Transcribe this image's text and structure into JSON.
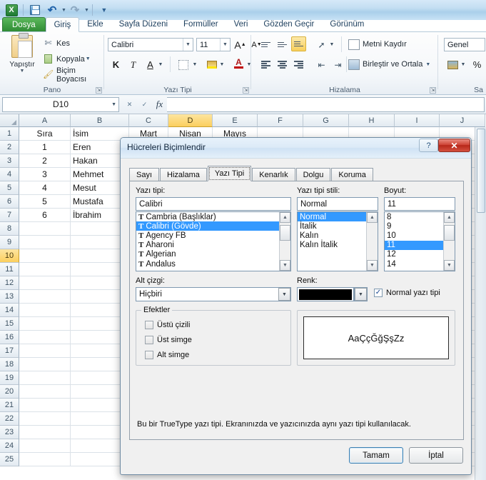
{
  "quick_access": {
    "app_icon": "excel-logo-icon",
    "items": [
      {
        "name": "save-icon",
        "label": ""
      },
      {
        "name": "undo-icon",
        "label": "↶"
      },
      {
        "name": "redo-icon",
        "label": "↷"
      },
      {
        "name": "customize-qat-icon",
        "label": "▾"
      }
    ]
  },
  "ribbon": {
    "tabs": [
      {
        "label": "Dosya",
        "state": "file"
      },
      {
        "label": "Giriş",
        "state": "active"
      },
      {
        "label": "Ekle",
        "state": "normal"
      },
      {
        "label": "Sayfa Düzeni",
        "state": "normal"
      },
      {
        "label": "Formüller",
        "state": "normal"
      },
      {
        "label": "Veri",
        "state": "normal"
      },
      {
        "label": "Gözden Geçir",
        "state": "normal"
      },
      {
        "label": "Görünüm",
        "state": "normal"
      }
    ],
    "groups": {
      "clipboard": {
        "label": "Pano",
        "paste": "Yapıştır",
        "cut": "Kes",
        "copy": "Kopyala",
        "format_painter": "Biçim Boyacısı"
      },
      "font": {
        "label": "Yazı Tipi",
        "font_name": "Calibri",
        "font_size": "11",
        "grow": "A",
        "shrink": "A",
        "bold": "K",
        "italic": "T",
        "underline": "A",
        "borders": "borders-icon",
        "fill": "fill-color-icon",
        "fontcolor": "A"
      },
      "alignment": {
        "label": "Hizalama",
        "wrap_text": "Metni Kaydır",
        "merge_center": "Birleştir ve Ortala"
      },
      "number": {
        "label": "Sa",
        "format": "Genel",
        "percent": "%"
      }
    }
  },
  "formula_bar": {
    "name_box": "D10",
    "formula": "",
    "fx_label": "fx",
    "cancel_icon": "cancel-icon",
    "accept_icon": "accept-icon"
  },
  "sheet": {
    "columns": [
      "A",
      "B",
      "C",
      "D",
      "E",
      "F",
      "G",
      "H",
      "I",
      "J"
    ],
    "selected_column": "D",
    "rows": [
      "1",
      "2",
      "3",
      "4",
      "5",
      "6",
      "7",
      "8",
      "9",
      "10",
      "11",
      "12",
      "13",
      "14",
      "15",
      "16",
      "17",
      "18",
      "19",
      "20",
      "21",
      "22",
      "23",
      "24",
      "25"
    ],
    "selected_row": "10",
    "active_cell": "D10",
    "data": [
      [
        "Sıra",
        "İsim",
        "Mart",
        "Nisan",
        "Mayıs",
        "",
        "",
        "",
        "",
        ""
      ],
      [
        "1",
        "Eren",
        "",
        "",
        "",
        "",
        "",
        "",
        "",
        ""
      ],
      [
        "2",
        "Hakan",
        "",
        "",
        "",
        "",
        "",
        "",
        "",
        ""
      ],
      [
        "3",
        "Mehmet",
        "",
        "",
        "",
        "",
        "",
        "",
        "",
        ""
      ],
      [
        "4",
        "Mesut",
        "",
        "",
        "",
        "",
        "",
        "",
        "",
        ""
      ],
      [
        "5",
        "Mustafa",
        "",
        "",
        "",
        "",
        "",
        "",
        "",
        ""
      ],
      [
        "6",
        "İbrahim",
        "",
        "",
        "",
        "",
        "",
        "",
        "",
        ""
      ]
    ]
  },
  "dialog": {
    "title": "Hücreleri Biçimlendir",
    "help_btn": "?",
    "close_btn": "✕",
    "tabs": [
      {
        "label": "Sayı",
        "active": false
      },
      {
        "label": "Hizalama",
        "active": false
      },
      {
        "label": "Yazı Tipi",
        "active": true
      },
      {
        "label": "Kenarlık",
        "active": false
      },
      {
        "label": "Dolgu",
        "active": false
      },
      {
        "label": "Koruma",
        "active": false
      }
    ],
    "font": {
      "label": "Yazı tipi:",
      "value": "Calibri",
      "options": [
        "Cambria (Başlıklar)",
        "Calibri (Gövde)",
        "Agency FB",
        "Aharoni",
        "Algerian",
        "Andalus"
      ],
      "selected_index": 1
    },
    "style": {
      "label": "Yazı tipi stili:",
      "value": "Normal",
      "options": [
        "Normal",
        "İtalik",
        "Kalın",
        "Kalın İtalik"
      ],
      "selected_index": 0
    },
    "size": {
      "label": "Boyut:",
      "value": "11",
      "options": [
        "8",
        "9",
        "10",
        "11",
        "12",
        "14"
      ],
      "selected_index": 3
    },
    "underline": {
      "label": "Alt çizgi:",
      "value": "Hiçbiri"
    },
    "color": {
      "label": "Renk:",
      "value": "#000000"
    },
    "normal_font": {
      "label": "Normal yazı tipi",
      "checked": true
    },
    "effects": {
      "legend": "Efektler",
      "items": [
        {
          "label": "Üstü çizili",
          "checked": false
        },
        {
          "label": "Üst simge",
          "checked": false
        },
        {
          "label": "Alt simge",
          "checked": false
        }
      ]
    },
    "preview": {
      "text": "AaÇçĞğŞşZz"
    },
    "note": "Bu bir TrueType yazı tipi. Ekranınızda ve yazıcınızda aynı yazı tipi kullanılacak.",
    "buttons": {
      "ok": "Tamam",
      "cancel": "İptal"
    }
  }
}
